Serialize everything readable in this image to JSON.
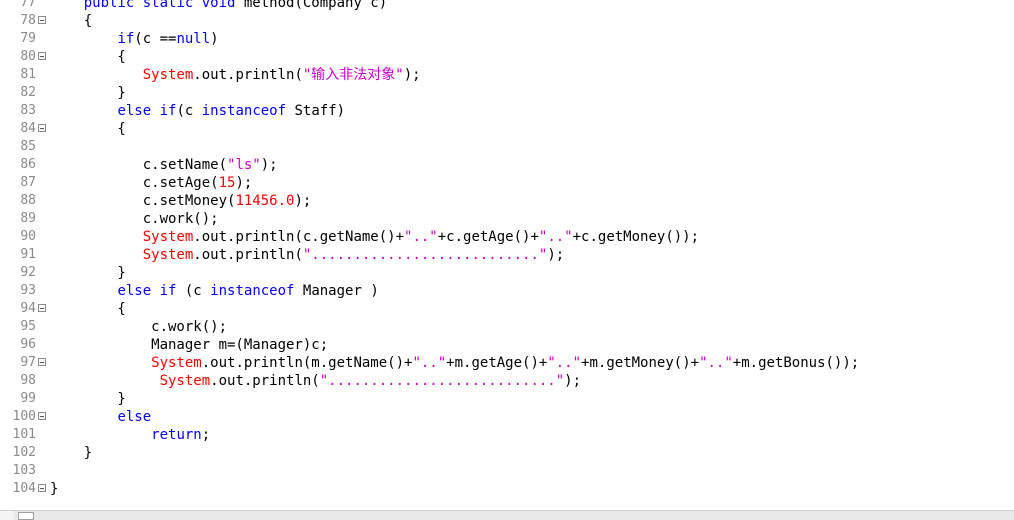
{
  "editor": {
    "lines": [
      {
        "num": "77",
        "fold": false,
        "tokens": [
          {
            "t": "    "
          },
          {
            "c": "kw",
            "t": "public static void"
          },
          {
            "t": " method(Company c)"
          }
        ]
      },
      {
        "num": "78",
        "fold": true,
        "tokens": [
          {
            "t": "    {"
          }
        ]
      },
      {
        "num": "79",
        "fold": false,
        "tokens": [
          {
            "t": "        "
          },
          {
            "c": "kw",
            "t": "if"
          },
          {
            "t": "(c =="
          },
          {
            "c": "kw",
            "t": "null"
          },
          {
            "t": ")"
          }
        ]
      },
      {
        "num": "80",
        "fold": true,
        "tokens": [
          {
            "t": "        {"
          }
        ]
      },
      {
        "num": "81",
        "fold": false,
        "tokens": [
          {
            "t": "           "
          },
          {
            "c": "cls",
            "t": "System"
          },
          {
            "t": ".out.println("
          },
          {
            "c": "str",
            "t": "\"输入非法对象\""
          },
          {
            "t": ");"
          }
        ]
      },
      {
        "num": "82",
        "fold": false,
        "tokens": [
          {
            "t": "        }"
          }
        ]
      },
      {
        "num": "83",
        "fold": false,
        "tokens": [
          {
            "t": "        "
          },
          {
            "c": "kw",
            "t": "else if"
          },
          {
            "t": "(c "
          },
          {
            "c": "kw",
            "t": "instanceof"
          },
          {
            "t": " Staff)"
          }
        ]
      },
      {
        "num": "84",
        "fold": true,
        "tokens": [
          {
            "t": "        {"
          }
        ]
      },
      {
        "num": "85",
        "fold": false,
        "tokens": [
          {
            "t": ""
          }
        ]
      },
      {
        "num": "86",
        "fold": false,
        "tokens": [
          {
            "t": "           c.setName("
          },
          {
            "c": "str",
            "t": "\"ls\""
          },
          {
            "t": ");"
          }
        ]
      },
      {
        "num": "87",
        "fold": false,
        "tokens": [
          {
            "t": "           c.setAge("
          },
          {
            "c": "num",
            "t": "15"
          },
          {
            "t": ");"
          }
        ]
      },
      {
        "num": "88",
        "fold": false,
        "tokens": [
          {
            "t": "           c.setMoney("
          },
          {
            "c": "num",
            "t": "11456.0"
          },
          {
            "t": ");"
          }
        ]
      },
      {
        "num": "89",
        "fold": false,
        "tokens": [
          {
            "t": "           c.work();"
          }
        ]
      },
      {
        "num": "90",
        "fold": false,
        "tokens": [
          {
            "t": "           "
          },
          {
            "c": "cls",
            "t": "System"
          },
          {
            "t": ".out.println(c.getName()+"
          },
          {
            "c": "str",
            "t": "\"..\""
          },
          {
            "t": "+c.getAge()+"
          },
          {
            "c": "str",
            "t": "\"..\""
          },
          {
            "t": "+c.getMoney());"
          }
        ]
      },
      {
        "num": "91",
        "fold": false,
        "tokens": [
          {
            "t": "           "
          },
          {
            "c": "cls",
            "t": "System"
          },
          {
            "t": ".out.println("
          },
          {
            "c": "str",
            "t": "\"...........................\""
          },
          {
            "t": ");"
          }
        ]
      },
      {
        "num": "92",
        "fold": false,
        "tokens": [
          {
            "t": "        }"
          }
        ]
      },
      {
        "num": "93",
        "fold": false,
        "tokens": [
          {
            "t": "        "
          },
          {
            "c": "kw",
            "t": "else if"
          },
          {
            "t": " (c "
          },
          {
            "c": "kw",
            "t": "instanceof"
          },
          {
            "t": " Manager )"
          }
        ]
      },
      {
        "num": "94",
        "fold": true,
        "tokens": [
          {
            "t": "        {"
          }
        ]
      },
      {
        "num": "95",
        "fold": false,
        "tokens": [
          {
            "t": "            c.work();"
          }
        ]
      },
      {
        "num": "96",
        "fold": false,
        "tokens": [
          {
            "t": "            Manager m=(Manager)c;"
          }
        ]
      },
      {
        "num": "97",
        "fold": true,
        "tokens": [
          {
            "t": "            "
          },
          {
            "c": "cls",
            "t": "System"
          },
          {
            "t": ".out.println(m.getName()+"
          },
          {
            "c": "str",
            "t": "\"..\""
          },
          {
            "t": "+m.getAge()+"
          },
          {
            "c": "str",
            "t": "\"..\""
          },
          {
            "t": "+m.getMoney()+"
          },
          {
            "c": "str",
            "t": "\"..\""
          },
          {
            "t": "+m.getBonus());"
          }
        ]
      },
      {
        "num": "98",
        "fold": false,
        "tokens": [
          {
            "t": "             "
          },
          {
            "c": "cls",
            "t": "System"
          },
          {
            "t": ".out.println("
          },
          {
            "c": "str",
            "t": "\"...........................\""
          },
          {
            "t": ");"
          }
        ]
      },
      {
        "num": "99",
        "fold": false,
        "tokens": [
          {
            "t": "        }"
          }
        ]
      },
      {
        "num": "100",
        "fold": true,
        "tokens": [
          {
            "t": "        "
          },
          {
            "c": "kw",
            "t": "else"
          }
        ]
      },
      {
        "num": "101",
        "fold": false,
        "tokens": [
          {
            "t": "            "
          },
          {
            "c": "kw",
            "t": "return"
          },
          {
            "t": ";"
          }
        ]
      },
      {
        "num": "102",
        "fold": false,
        "tokens": [
          {
            "t": "    }"
          }
        ]
      },
      {
        "num": "103",
        "fold": false,
        "tokens": [
          {
            "t": ""
          }
        ]
      },
      {
        "num": "104",
        "fold": true,
        "tokens": [
          {
            "t": "}"
          }
        ]
      }
    ]
  },
  "colors": {
    "keyword": "#0000ff",
    "class": "#ff0000",
    "string": "#cc00cc",
    "number": "#ff0000",
    "line_number": "#8a8a8a",
    "background": "#ffffff"
  },
  "icons": {
    "fold": "fold-toggle-icon"
  }
}
